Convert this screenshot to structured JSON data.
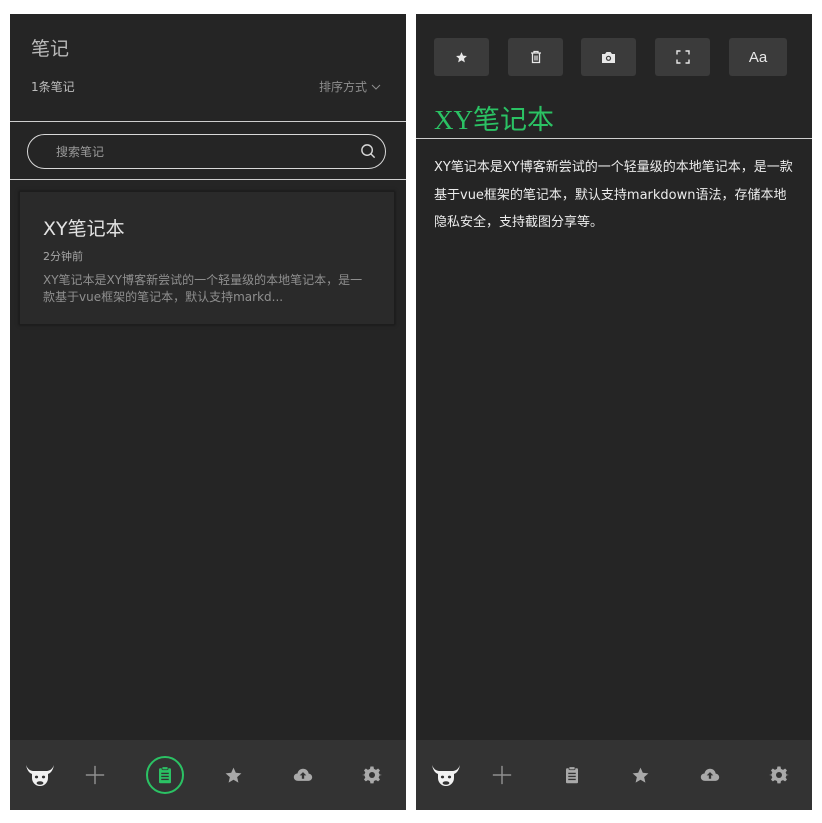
{
  "list_panel": {
    "title": "笔记",
    "count_label": "1条笔记",
    "sort_label": "排序方式",
    "search": {
      "placeholder": "搜索笔记",
      "value": ""
    },
    "notes": [
      {
        "title": "XY笔记本",
        "time": "2分钟前",
        "excerpt": "XY笔记本是XY博客新尝试的一个轻量级的本地笔记本，是一款基于vue框架的笔记本，默认支持markd..."
      }
    ]
  },
  "editor_panel": {
    "toolbar": [
      {
        "name": "favorite-button",
        "icon": "star-icon"
      },
      {
        "name": "delete-button",
        "icon": "trash-icon"
      },
      {
        "name": "screenshot-button",
        "icon": "camera-icon"
      },
      {
        "name": "fullscreen-button",
        "icon": "expand-icon"
      },
      {
        "name": "font-button",
        "label": "Aa"
      }
    ],
    "note_title": "XY笔记本",
    "note_body": "XY笔记本是XY博客新尝试的一个轻量级的本地笔记本，是一款基于vue框架的笔记本，默认支持markdown语法，存储本地隐私安全，支持截图分享等。"
  },
  "bottom_nav": {
    "items": [
      {
        "name": "nav-logo",
        "icon": "bull-logo-icon"
      },
      {
        "name": "nav-add",
        "icon": "plus-icon"
      },
      {
        "name": "nav-notes",
        "icon": "clipboard-icon"
      },
      {
        "name": "nav-favorites",
        "icon": "star-icon"
      },
      {
        "name": "nav-cloud",
        "icon": "cloud-upload-icon"
      },
      {
        "name": "nav-settings",
        "icon": "gear-icon"
      }
    ],
    "left_active": "nav-notes",
    "right_active": ""
  },
  "colors": {
    "accent": "#2bc264",
    "panel_bg": "#252525",
    "nav_bg": "#333333",
    "toolbar_btn_bg": "#3b3b3b",
    "text_primary": "#e2e2e2",
    "text_muted": "#8f8f8f"
  }
}
